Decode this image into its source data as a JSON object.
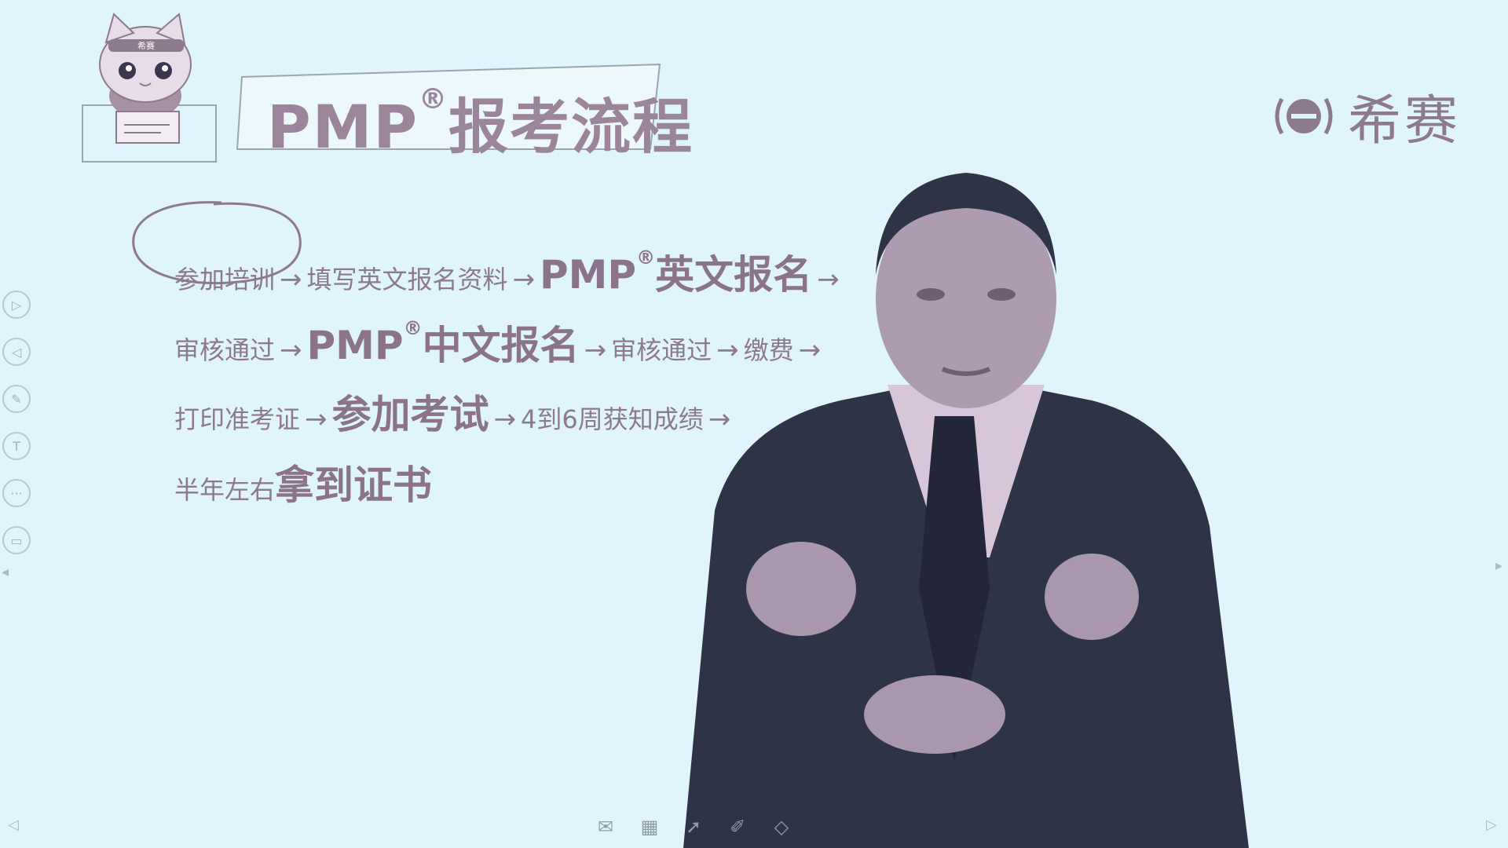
{
  "header": {
    "title_prefix": "PMP",
    "title_reg": "®",
    "title_main": "报考流程",
    "mascot_tag": "希赛",
    "brand_text": "希赛",
    "brand_logo_glyph": "e"
  },
  "flow": {
    "row1": {
      "s1": "参加培训",
      "a1": "→",
      "s2": "填写英文报名资料",
      "a2": "→",
      "big_prefix": "PMP",
      "big_reg": "®",
      "big_main": "英文报名",
      "a3": "→"
    },
    "row2": {
      "s1": "审核通过",
      "a1": "→",
      "big_prefix": "PMP",
      "big_reg": "®",
      "big_main": "中文报名",
      "a2": "→",
      "s2": "审核通过",
      "a3": "→",
      "s3": "缴费",
      "a4": "→"
    },
    "row3": {
      "s1": "打印准考证",
      "a1": "→",
      "big": "参加考试",
      "a2": "→",
      "s2": "4到6周获知成绩",
      "a3": "→"
    },
    "row4": {
      "s1": "半年左右",
      "big": "拿到证书"
    }
  },
  "left_toolbar": {
    "icons": [
      "play-next-icon",
      "play-prev-icon",
      "pen-icon",
      "text-icon",
      "more-icon",
      "screen-icon"
    ]
  },
  "bottom_toolbar": {
    "icons": [
      "mail-icon",
      "grid-icon",
      "pointer-icon",
      "brush-icon",
      "eraser-icon"
    ]
  },
  "colors": {
    "background": "#dff4fb",
    "text": "#8d7a8d",
    "suit": "#2f3348",
    "shirt": "#d7c6d8"
  }
}
